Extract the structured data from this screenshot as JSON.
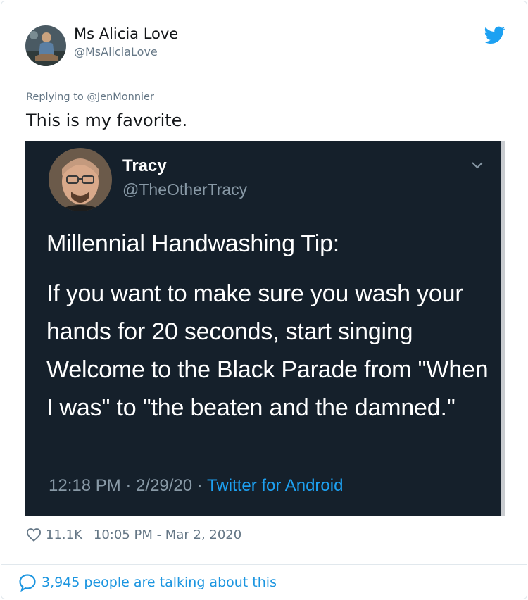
{
  "tweet": {
    "author_name": "Ms Alicia Love",
    "author_handle": "@MsAliciaLove",
    "replying_prefix": "Replying to",
    "replying_to": "@JenMonnier",
    "text": "This is my favorite.",
    "likes": "11.1K",
    "timestamp": "10:05 PM - Mar 2, 2020",
    "talking": "3,945 people are talking about this"
  },
  "embedded": {
    "author_name": "Tracy",
    "author_handle": "@TheOtherTracy",
    "heading": "Millennial Handwashing Tip:",
    "body": "If you want to make sure you wash your hands for 20 seconds, start singing Welcome to the Black Parade from \"When I was\" to \"the beaten and the damned.\"",
    "meta_time": "12:18 PM · 2/29/20 · ",
    "meta_source": "Twitter for Android"
  },
  "icons": {
    "brand": "twitter-bird-icon",
    "like": "heart-icon",
    "talk": "speech-bubble-icon",
    "menu": "chevron-down-icon"
  },
  "colors": {
    "brand_blue": "#1da1f2",
    "dark_bg": "#15202b",
    "muted": "#657786"
  }
}
